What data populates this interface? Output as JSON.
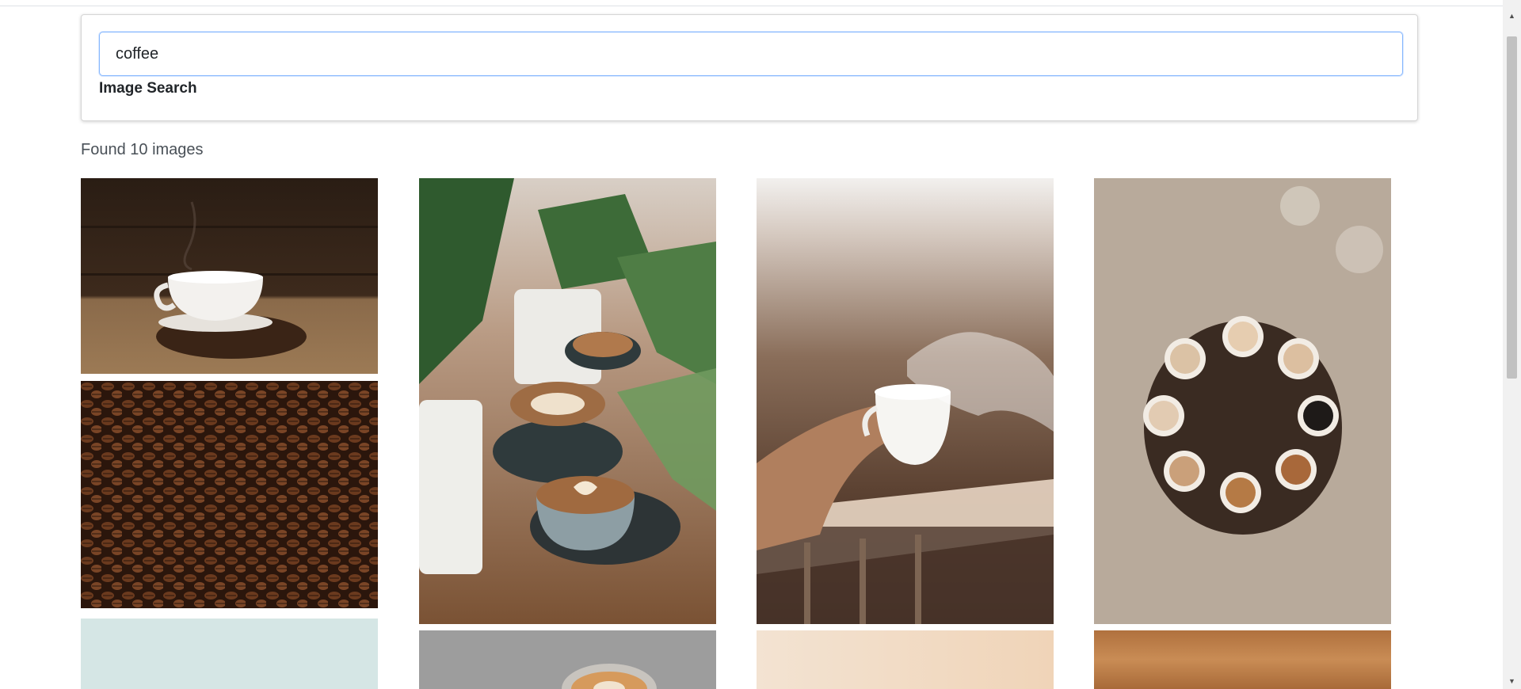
{
  "search": {
    "query": "coffee",
    "placeholder": "",
    "label": "Image Search"
  },
  "results": {
    "count_text": "Found 10 images"
  },
  "images": [
    {
      "subject": "White cup on saucer with coffee beans, wooden background"
    },
    {
      "subject": "Pile of roasted coffee beans"
    },
    {
      "subject": "Pale blue background (partially visible)"
    },
    {
      "subject": "Latte art cups on wooden table with plants"
    },
    {
      "subject": "Grey background with latte (partially visible)"
    },
    {
      "subject": "Hand holding steaming white mug by a balcony"
    },
    {
      "subject": "Peach gradient background (partially visible)"
    },
    {
      "subject": "Overhead view of cups of coffee on round wooden table"
    },
    {
      "subject": "Blurred wooden surface (partially visible)"
    }
  ],
  "colors": {
    "accent_border": "#86b7fe",
    "text": "#212529",
    "muted_text": "#495057"
  }
}
